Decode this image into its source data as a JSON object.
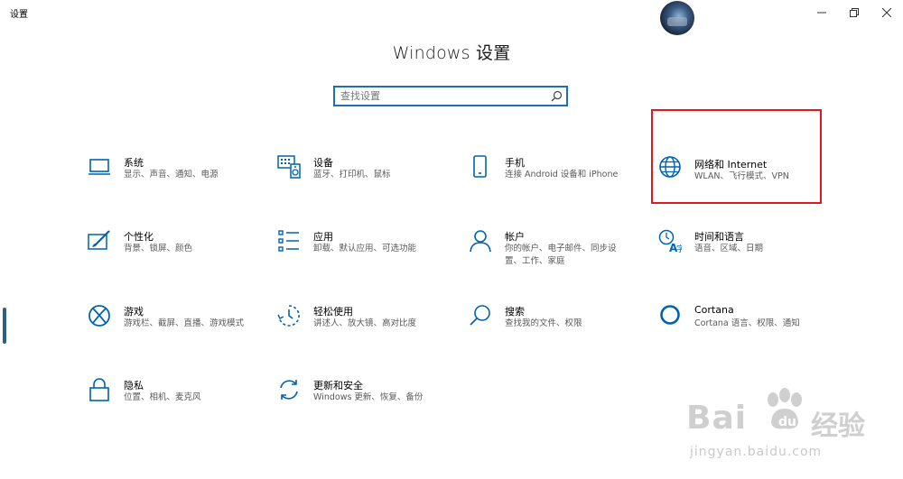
{
  "window": {
    "title": "设置",
    "controls": [
      "minimize-icon",
      "restore-icon",
      "close-icon"
    ]
  },
  "page": {
    "title": "Windows 设置"
  },
  "search": {
    "placeholder": "查找设置",
    "value": ""
  },
  "accent_color": "#0063b1",
  "highlight_color": "#e0191c",
  "tiles": [
    {
      "id": "system",
      "icon": "laptop-icon",
      "title": "系统",
      "desc": "显示、声音、通知、电源"
    },
    {
      "id": "devices",
      "icon": "keyboard-speaker-icon",
      "title": "设备",
      "desc": "蓝牙、打印机、鼠标"
    },
    {
      "id": "phone",
      "icon": "phone-icon",
      "title": "手机",
      "desc": "连接 Android 设备和 iPhone"
    },
    {
      "id": "network",
      "icon": "globe-icon",
      "title": "网络和 Internet",
      "desc": "WLAN、飞行模式、VPN"
    },
    {
      "id": "personalization",
      "icon": "paint-brush-icon",
      "title": "个性化",
      "desc": "背景、锁屏、颜色"
    },
    {
      "id": "apps",
      "icon": "app-list-icon",
      "title": "应用",
      "desc": "卸载、默认应用、可选功能"
    },
    {
      "id": "accounts",
      "icon": "person-icon",
      "title": "帐户",
      "desc": "你的帐户、电子邮件、同步设置、工作、家庭"
    },
    {
      "id": "time-language",
      "icon": "clock-language-icon",
      "title": "时间和语言",
      "desc": "语音、区域、日期"
    },
    {
      "id": "gaming",
      "icon": "xbox-icon",
      "title": "游戏",
      "desc": "游戏栏、截屏、直播、游戏模式"
    },
    {
      "id": "ease-of-access",
      "icon": "ease-of-access-icon",
      "title": "轻松使用",
      "desc": "讲述人、放大镜、高对比度"
    },
    {
      "id": "search",
      "icon": "magnifier-icon",
      "title": "搜索",
      "desc": "查找我的文件、权限"
    },
    {
      "id": "cortana",
      "icon": "cortana-ring-icon",
      "title": "Cortana",
      "desc": "Cortana 语言、权限、通知"
    },
    {
      "id": "privacy",
      "icon": "lock-icon",
      "title": "隐私",
      "desc": "位置、相机、麦克风"
    },
    {
      "id": "update-security",
      "icon": "sync-icon",
      "title": "更新和安全",
      "desc": "Windows 更新、恢复、备份"
    }
  ],
  "watermark": {
    "brand": "Bai",
    "brand2": "经验",
    "url": "jingyan.baidu.com"
  }
}
